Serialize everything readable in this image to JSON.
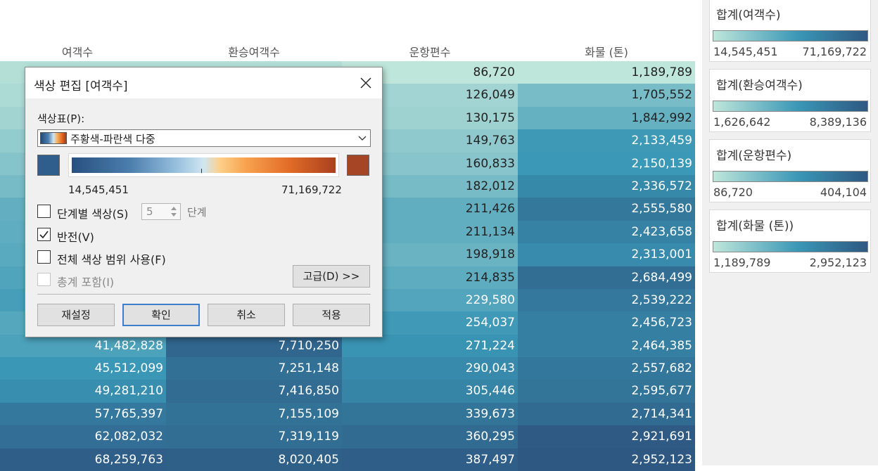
{
  "table": {
    "columns": [
      "여객수",
      "환승여객수",
      "운항편수",
      "화물 (톤)"
    ],
    "rows": [
      [
        "",
        "",
        "86,720",
        "1,189,789"
      ],
      [
        "",
        "",
        "126,049",
        "1,705,552"
      ],
      [
        "",
        "",
        "130,175",
        "1,842,992"
      ],
      [
        "",
        "",
        "149,763",
        "2,133,459"
      ],
      [
        "",
        "",
        "160,833",
        "2,150,139"
      ],
      [
        "",
        "",
        "182,012",
        "2,336,572"
      ],
      [
        "",
        "",
        "211,426",
        "2,555,580"
      ],
      [
        "",
        "",
        "211,134",
        "2,423,658"
      ],
      [
        "",
        "",
        "198,918",
        "2,313,001"
      ],
      [
        "",
        "",
        "214,835",
        "2,684,499"
      ],
      [
        "",
        "",
        "229,580",
        "2,539,222"
      ],
      [
        "",
        "",
        "254,037",
        "2,456,723"
      ],
      [
        "41,482,828",
        "7,710,250",
        "271,224",
        "2,464,385"
      ],
      [
        "45,512,099",
        "7,251,148",
        "290,043",
        "2,557,682"
      ],
      [
        "49,281,210",
        "7,416,850",
        "305,446",
        "2,595,677"
      ],
      [
        "57,765,397",
        "7,155,109",
        "339,673",
        "2,714,341"
      ],
      [
        "62,082,032",
        "7,319,119",
        "360,295",
        "2,921,691"
      ],
      [
        "68,259,763",
        "8,020,405",
        "387,497",
        "2,952,123"
      ]
    ],
    "ranges": [
      [
        14545451,
        71169722
      ],
      [
        1626642,
        8389136
      ],
      [
        86720,
        404104
      ],
      [
        1189789,
        2952123
      ]
    ],
    "hidden_levels": [
      [
        0.05,
        0.08,
        0.12,
        0.18,
        0.24,
        0.3,
        0.38,
        0.4,
        0.42,
        0.46,
        0.5,
        0.44
      ],
      [
        0.05,
        0.35,
        0.4,
        0.45,
        0.5,
        0.55,
        0.6,
        0.62,
        0.63,
        0.7,
        0.72,
        0.78
      ]
    ],
    "colors": {
      "low": "#bfe6da",
      "mid": "#3a97b6",
      "high": "#2e5882"
    }
  },
  "legends": [
    {
      "title": "합계(여객수)",
      "min": "14,545,451",
      "max": "71,169,722"
    },
    {
      "title": "합계(환승여객수)",
      "min": "1,626,642",
      "max": "8,389,136"
    },
    {
      "title": "합계(운항편수)",
      "min": "86,720",
      "max": "404,104"
    },
    {
      "title": "합계(화물 (톤))",
      "min": "1,189,789",
      "max": "2,952,123"
    }
  ],
  "dialog": {
    "title": "색상 편집 [여객수]",
    "close_icon": "close-icon",
    "palette_label": "색상표(P):",
    "palette_value": "주황색-파란색 다중",
    "range_min": "14,545,451",
    "range_max": "71,169,722",
    "stepped_color_label": "단계별 색상(S)",
    "stepped_color_checked": false,
    "steps_value": "5",
    "steps_label": "단계",
    "reversed_label": "반전(V)",
    "reversed_checked": true,
    "full_range_label": "전체 색상 범위 사용(F)",
    "full_range_checked": false,
    "include_totals_label": "총계 포함(I)",
    "include_totals_checked": false,
    "advanced_label": "고급(D) >>",
    "reset_label": "재설정",
    "ok_label": "확인",
    "cancel_label": "취소",
    "apply_label": "적용",
    "start_color": "#2f5d8c",
    "end_color": "#a64426"
  }
}
